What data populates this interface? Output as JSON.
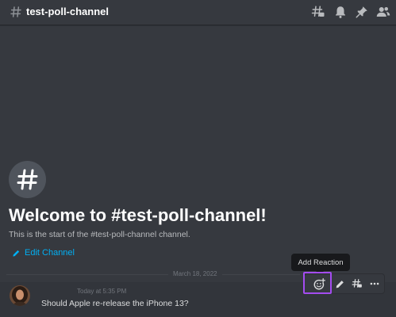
{
  "header": {
    "channel_name": "test-poll-channel",
    "icons": [
      "threads-icon",
      "bell-icon",
      "pin-icon",
      "members-icon"
    ]
  },
  "welcome": {
    "title": "Welcome to #test-poll-channel!",
    "subtitle": "This is the start of the #test-poll-channel channel.",
    "edit_label": "Edit Channel"
  },
  "divider": {
    "date": "March 18, 2022"
  },
  "message": {
    "timestamp": "Today at 5:35 PM",
    "text": "Should Apple re-release the iPhone 13?"
  },
  "tooltip": {
    "text": "Add Reaction"
  },
  "toolbar": {
    "icons": [
      "add-reaction-icon",
      "edit-icon",
      "thread-icon",
      "more-icon"
    ]
  },
  "colors": {
    "background": "#36393f",
    "link": "#00b0f4",
    "highlight": "#a44cf0"
  }
}
